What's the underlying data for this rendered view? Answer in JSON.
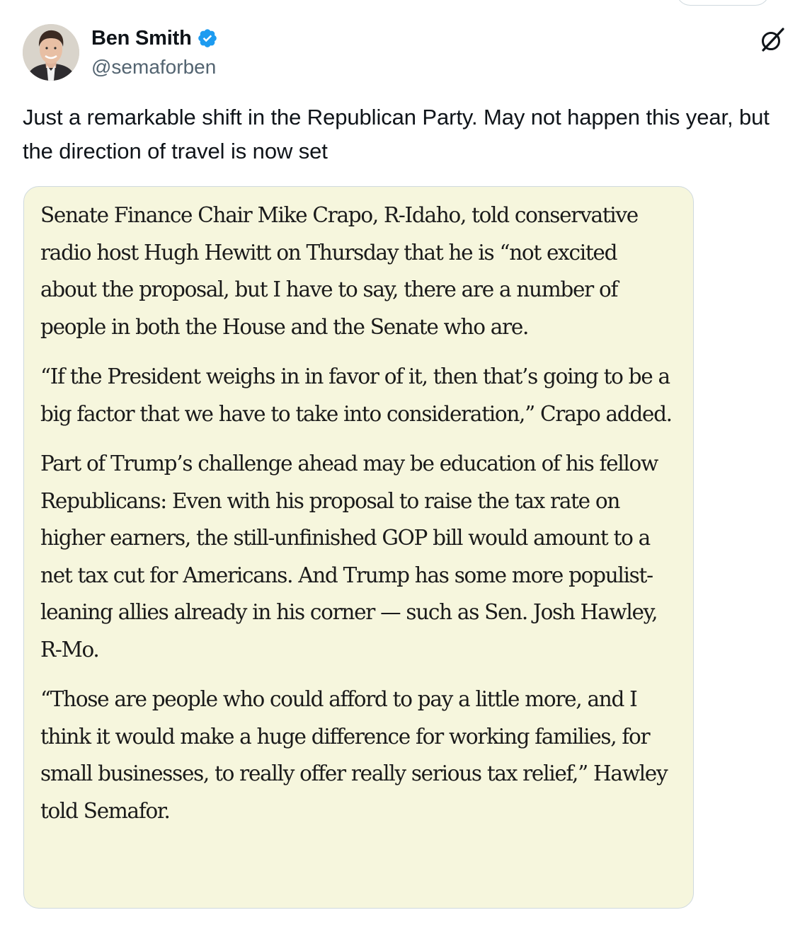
{
  "post": {
    "author_name": "Ben Smith",
    "author_handle": "@semaforben",
    "text": "Just a remarkable shift in the Republican Party. May not happen this year, but the direction of travel is now set"
  },
  "colors": {
    "verified": "#1d9bf0",
    "quote_background": "#f6f6dd",
    "handle": "#536471"
  },
  "icons": {
    "verified": "verified-badge-icon",
    "grok": "grok-icon"
  },
  "quote_image": {
    "paragraphs": [
      "Senate Finance Chair Mike Crapo, R-Idaho, told conservative radio host Hugh Hewitt on Thursday that he is “not excited about the proposal, but I have to say, there are a number of people in both the House and the Senate who are.",
      "“If the President weighs in in favor of it, then that’s going to be a big factor that we have to take into consideration,” Crapo added.",
      "Part of Trump’s challenge ahead may be education of his fellow Republicans: Even with his proposal to raise the tax rate on higher earners, the still-unfinished GOP bill would amount to a net tax cut for Americans. And Trump has some more populist-leaning allies already in his corner — such as Sen. Josh Hawley, R-Mo.",
      "“Those are people who could afford to pay a little more, and I think it would make a huge difference for working families, for small businesses, to really offer really serious tax relief,” Hawley told Semafor."
    ]
  }
}
